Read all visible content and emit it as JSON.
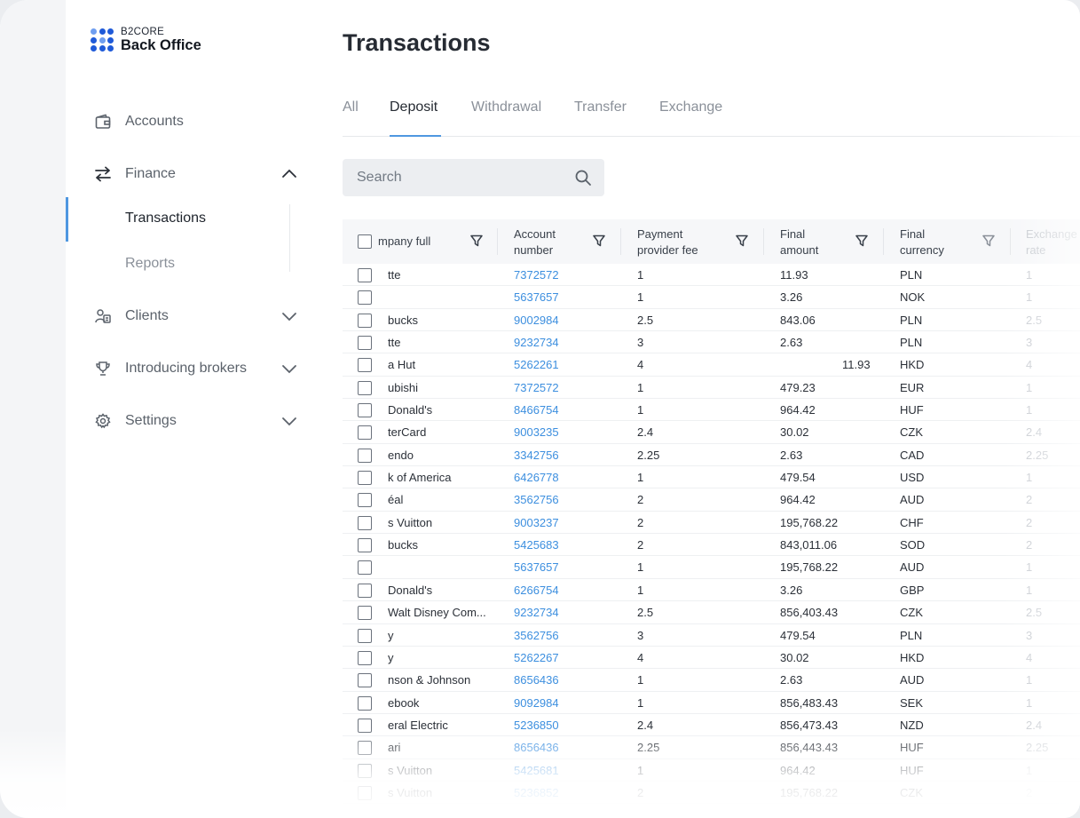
{
  "brand": {
    "top": "B2CORE",
    "bottom": "Back Office",
    "accent": "#4f97e0",
    "logo_color": "#1f5ad8"
  },
  "sidebar": {
    "items": [
      {
        "label": "Accounts",
        "icon": "wallet-icon"
      },
      {
        "label": "Finance",
        "icon": "transfer-arrows-icon",
        "expanded": true
      },
      {
        "label": "Clients",
        "icon": "clients-icon"
      },
      {
        "label": "Introducing brokers",
        "icon": "trophy-icon"
      },
      {
        "label": "Settings",
        "icon": "gear-icon"
      }
    ],
    "finance_sub": [
      {
        "label": "Transactions",
        "active": true
      },
      {
        "label": "Reports"
      }
    ]
  },
  "page": {
    "title": "Transactions"
  },
  "tabs": [
    {
      "label": "All"
    },
    {
      "label": "Deposit",
      "active": true
    },
    {
      "label": "Withdrawal"
    },
    {
      "label": "Transfer"
    },
    {
      "label": "Exchange"
    }
  ],
  "search": {
    "placeholder": "Search"
  },
  "table": {
    "columns": [
      {
        "line1": "mpany full",
        "line2": ""
      },
      {
        "line1": "Account",
        "line2": "number"
      },
      {
        "line1": "Payment",
        "line2": "provider fee"
      },
      {
        "line1": "Final",
        "line2": "amount"
      },
      {
        "line1": "Final",
        "line2": "currency"
      },
      {
        "line1": "Exchange",
        "line2": "rate"
      }
    ],
    "rows": [
      [
        "tte",
        "7372572",
        "1",
        "11.93",
        "PLN",
        "1"
      ],
      [
        "",
        "5637657",
        "1",
        "3.26",
        "NOK",
        "1"
      ],
      [
        "bucks",
        "9002984",
        "2.5",
        "843.06",
        "PLN",
        "2.5"
      ],
      [
        "tte",
        "9232734",
        "3",
        "2.63",
        "PLN",
        "3"
      ],
      [
        "a Hut",
        "5262261",
        "4",
        "11.93",
        "HKD",
        "4"
      ],
      [
        "ubishi",
        "7372572",
        "1",
        "479.23",
        "EUR",
        "1"
      ],
      [
        "Donald's",
        "8466754",
        "1",
        "964.42",
        "HUF",
        "1"
      ],
      [
        "terCard",
        "9003235",
        "2.4",
        "30.02",
        "CZK",
        "2.4"
      ],
      [
        "endo",
        "3342756",
        "2.25",
        "2.63",
        "CAD",
        "2.25"
      ],
      [
        "k of America",
        "6426778",
        "1",
        "479.54",
        "USD",
        "1"
      ],
      [
        "éal",
        "3562756",
        "2",
        "964.42",
        "AUD",
        "2"
      ],
      [
        "s Vuitton",
        "9003237",
        "2",
        "195,768.22",
        "CHF",
        "2"
      ],
      [
        "bucks",
        "5425683",
        "2",
        "843,011.06",
        "SOD",
        "2"
      ],
      [
        "",
        "5637657",
        "1",
        "195,768.22",
        "AUD",
        "1"
      ],
      [
        "Donald's",
        "6266754",
        "1",
        "3.26",
        "GBP",
        "1"
      ],
      [
        "Walt Disney Com...",
        "9232734",
        "2.5",
        "856,403.43",
        "CZK",
        "2.5"
      ],
      [
        "y",
        "3562756",
        "3",
        "479.54",
        "PLN",
        "3"
      ],
      [
        "y",
        "5262267",
        "4",
        "30.02",
        "HKD",
        "4"
      ],
      [
        "nson & Johnson",
        "8656436",
        "1",
        "2.63",
        "AUD",
        "1"
      ],
      [
        "ebook",
        "9092984",
        "1",
        "856,483.43",
        "SEK",
        "1"
      ],
      [
        "eral Electric",
        "5236850",
        "2.4",
        "856,473.43",
        "NZD",
        "2.4"
      ],
      [
        "ari",
        "8656436",
        "2.25",
        "856,443.43",
        "HUF",
        "2.25"
      ],
      [
        "s Vuitton",
        "5425681",
        "1",
        "964.42",
        "HUF",
        "1"
      ],
      [
        "s Vuitton",
        "5236852",
        "2",
        "195,768.22",
        "CZK",
        "2"
      ]
    ]
  }
}
